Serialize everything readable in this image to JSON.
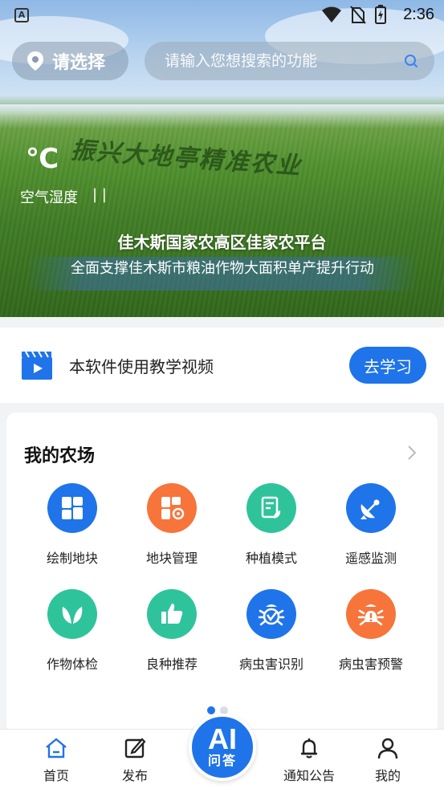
{
  "status_bar": {
    "time": "2:36",
    "left_icon": "A"
  },
  "header": {
    "location_label": "请选择",
    "search_placeholder": "请输入您想搜索的功能"
  },
  "weather": {
    "temperature_unit": "℃",
    "humidity_label": "空气湿度",
    "humidity_value": "| |"
  },
  "banner": {
    "slogan": "振兴大地亭精准农业",
    "title": "佳木斯国家农高区佳家农平台",
    "subtitle": "全面支撑佳木斯市粮油作物大面积单产提升行动"
  },
  "tutorial": {
    "text": "本软件使用教学视频",
    "button_label": "去学习",
    "icon": "video-clapper-icon"
  },
  "farm": {
    "title": "我的农场",
    "items": [
      {
        "label": "绘制地块",
        "color": "#1f74e9",
        "icon": "draw-plot-icon"
      },
      {
        "label": "地块管理",
        "color": "#f7743a",
        "icon": "plot-manage-icon"
      },
      {
        "label": "种植模式",
        "color": "#2fc39c",
        "icon": "planting-mode-icon"
      },
      {
        "label": "遥感监测",
        "color": "#1f74e9",
        "icon": "satellite-icon"
      },
      {
        "label": "作物体检",
        "color": "#2fc39c",
        "icon": "leaf-icon"
      },
      {
        "label": "良种推荐",
        "color": "#2fc39c",
        "icon": "thumbs-up-icon"
      },
      {
        "label": "病虫害识别",
        "color": "#1f74e9",
        "icon": "bug-icon"
      },
      {
        "label": "病虫害预警",
        "color": "#f7743a",
        "icon": "bug-alert-icon"
      }
    ]
  },
  "tabs": [
    {
      "label": "首页",
      "icon": "home-icon",
      "active": true
    },
    {
      "label": "发布",
      "icon": "edit-icon",
      "active": false
    },
    {
      "label": "通知公告",
      "icon": "bell-icon",
      "active": false
    },
    {
      "label": "我的",
      "icon": "user-icon",
      "active": false
    }
  ],
  "ai_button": {
    "big": "AI",
    "small": "问答"
  },
  "colors": {
    "primary": "#1f74e9",
    "orange": "#f7743a",
    "green": "#2fc39c"
  }
}
